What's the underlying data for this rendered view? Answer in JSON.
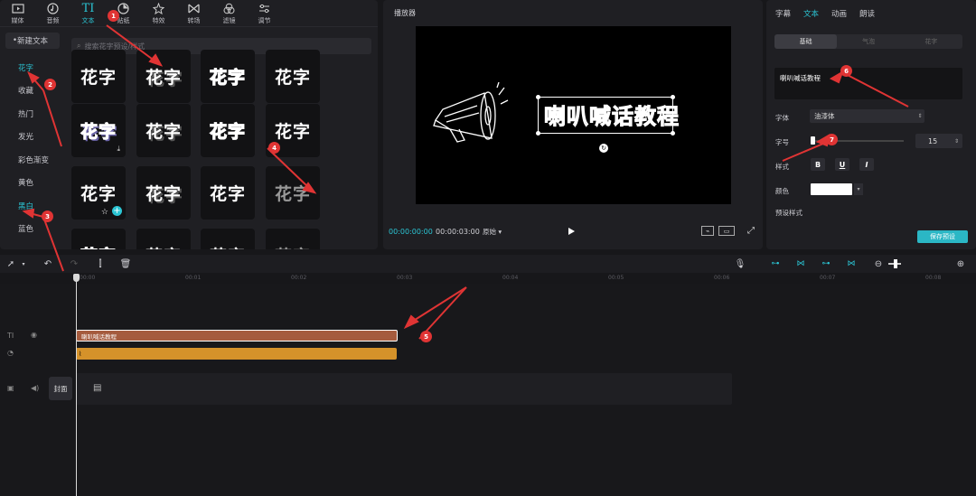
{
  "nav": {
    "tabs": [
      {
        "label": "媒体",
        "icon": "media-icon"
      },
      {
        "label": "音频",
        "icon": "audio-icon"
      },
      {
        "label": "文本",
        "icon": "text-icon"
      },
      {
        "label": "贴纸",
        "icon": "sticker-icon"
      },
      {
        "label": "特效",
        "icon": "effects-icon"
      },
      {
        "label": "转场",
        "icon": "transition-icon"
      },
      {
        "label": "滤镜",
        "icon": "filter-icon"
      },
      {
        "label": "调节",
        "icon": "adjust-icon"
      }
    ],
    "active": "文本"
  },
  "categories": {
    "new_text": "新建文本",
    "items": [
      "花字",
      "收藏",
      "热门",
      "发光",
      "彩色渐变",
      "黄色",
      "黑白",
      "蓝色"
    ],
    "active": "花字"
  },
  "search": {
    "placeholder": "搜索花字预设/样式"
  },
  "tiles": {
    "text": "花字"
  },
  "player": {
    "title": "播放器",
    "canvas_text": "喇叭喊话教程",
    "time_current": "00:00:00:00",
    "time_total": "00:00:03:00",
    "ratio": "原始"
  },
  "inspector": {
    "tabs": [
      "字幕",
      "文本",
      "动画",
      "朗读"
    ],
    "active_tab": "文本",
    "sub_tabs": [
      "基础",
      "气泡",
      "花字"
    ],
    "active_sub_tab": "基础",
    "text_value": "喇叭喊话教程",
    "font_label": "字体",
    "font_value": "油漆体",
    "size_label": "字号",
    "size_value": "15",
    "style_label": "样式",
    "style_buttons": [
      "B",
      "U",
      "I"
    ],
    "color_label": "颜色",
    "color_value": "#ffffff",
    "preset_label": "预设样式",
    "save_preset": "保存预设"
  },
  "timeline": {
    "ticks": [
      "00:00",
      "00:01",
      "00:02",
      "00:03",
      "00:04",
      "00:05",
      "00:06",
      "00:07",
      "00:08"
    ],
    "text_clip_label": "喇叭喊话教程",
    "cover_label": "封面"
  },
  "annotations": [
    "1",
    "2",
    "3",
    "4",
    "5",
    "6",
    "7"
  ],
  "colors": {
    "accent": "#2bc5d4",
    "text_clip": "#a55b3e",
    "audio_clip": "#d5922a",
    "annotation": "#e03434"
  }
}
